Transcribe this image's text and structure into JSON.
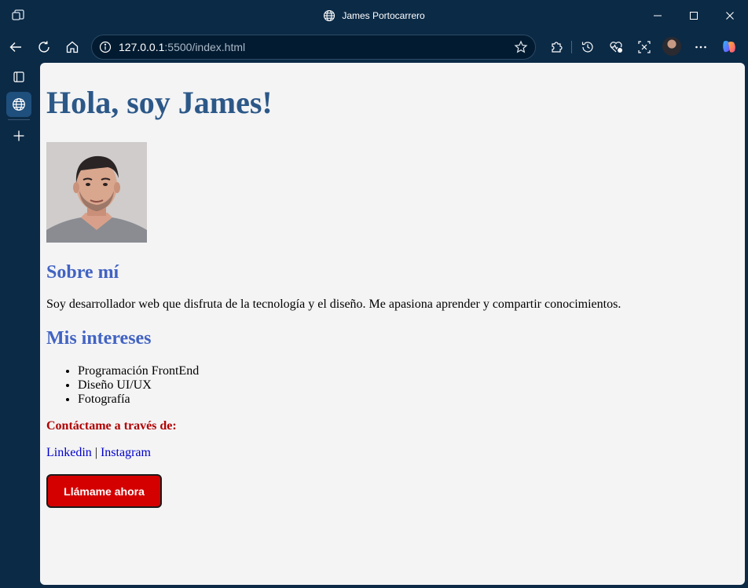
{
  "window": {
    "title": "James Portocarrero"
  },
  "browser": {
    "url_host": "127.0.0.1",
    "url_rest": ":5500/index.html"
  },
  "page": {
    "heading": "Hola, soy James!",
    "about_title": "Sobre mí",
    "about_text": "Soy desarrollador web que disfruta de la tecnología y el diseño. Me apasiona aprender y compartir conocimientos.",
    "interests_title": "Mis intereses",
    "interests": [
      "Programación FrontEnd",
      "Diseño UI/UX",
      "Fotografía"
    ],
    "contact_title": "Contáctame a través de:",
    "links": {
      "linkedin": "Linkedin",
      "separator": "|",
      "instagram": "Instagram"
    },
    "call_button": "Llámame ahora"
  },
  "colors": {
    "heading": "#2c5888",
    "section_title": "#4163c2",
    "contact_title": "#b00000",
    "button": "#d40000",
    "link": "#0000cc",
    "browser_chrome": "#0b2a46"
  }
}
